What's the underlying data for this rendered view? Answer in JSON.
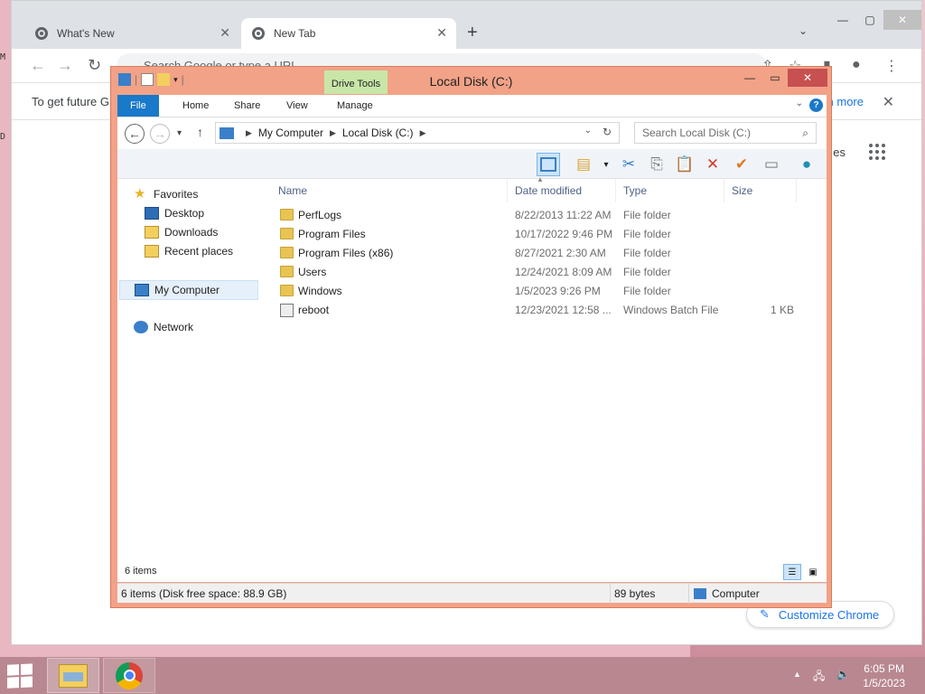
{
  "chrome": {
    "tabs": [
      {
        "label": "What's New",
        "active": false
      },
      {
        "label": "New Tab",
        "active": true
      }
    ],
    "new_tab": "+",
    "omnibox_placeholder": "Search Google or type a URL",
    "infobar": {
      "message": "To get future G",
      "link": "n more"
    },
    "apps_partial": "es",
    "customize_label": "Customize Chrome"
  },
  "explorer": {
    "title": "Local Disk (C:)",
    "drive_tools": "Drive Tools",
    "ribbon_tabs": [
      "File",
      "Home",
      "Share",
      "View",
      "Manage"
    ],
    "address": {
      "root": "My Computer",
      "current": "Local Disk (C:)"
    },
    "search_placeholder": "Search Local Disk (C:)",
    "nav": {
      "favorites": "Favorites",
      "desktop": "Desktop",
      "downloads": "Downloads",
      "recent": "Recent places",
      "computer": "My Computer",
      "network": "Network"
    },
    "columns": {
      "name": "Name",
      "date": "Date modified",
      "type": "Type",
      "size": "Size"
    },
    "files": [
      {
        "name": "PerfLogs",
        "date": "8/22/2013 11:22 AM",
        "type": "File folder",
        "size": ""
      },
      {
        "name": "Program Files",
        "date": "10/17/2022 9:46 PM",
        "type": "File folder",
        "size": ""
      },
      {
        "name": "Program Files (x86)",
        "date": "8/27/2021 2:30 AM",
        "type": "File folder",
        "size": ""
      },
      {
        "name": "Users",
        "date": "12/24/2021 8:09 AM",
        "type": "File folder",
        "size": ""
      },
      {
        "name": "Windows",
        "date": "1/5/2023 9:26 PM",
        "type": "File folder",
        "size": ""
      },
      {
        "name": "reboot",
        "date": "12/23/2021 12:58 ...",
        "type": "Windows Batch File",
        "size": "1 KB"
      }
    ],
    "item_count": "6 items",
    "status": {
      "left": "6 items (Disk free space: 88.9 GB)",
      "middle": "89 bytes",
      "right": "Computer"
    }
  },
  "taskbar": {
    "time": "6:05 PM",
    "date": "1/5/2023"
  },
  "colors": {
    "explorer_frame": "#f2a287",
    "ribbon_file": "#1979ca",
    "drive_tools": "#c9e6a8",
    "taskbar": "#b9878f"
  }
}
